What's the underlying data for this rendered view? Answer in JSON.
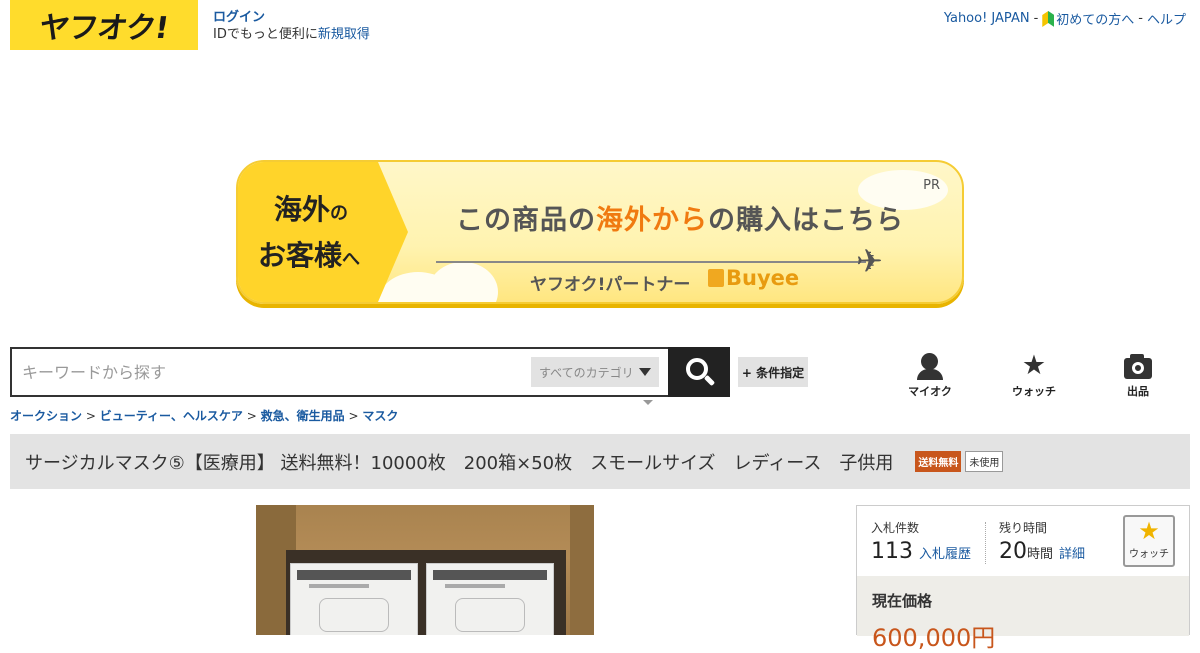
{
  "header": {
    "logo_text": "ヤフオク!",
    "login_label": "ログイン",
    "id_text": "IDでもっと便利に",
    "signup_link": "新規取得",
    "links": [
      "Yahoo! JAPAN",
      "初めての方へ",
      "ヘルプ"
    ],
    "separator": "-"
  },
  "banner": {
    "left_line1": "海外",
    "left_line1_suffix": "の",
    "left_line2": "お客様",
    "left_line2_suffix": "へ",
    "main_pre": "この商品の",
    "main_highlight": "海外から",
    "main_post": "の購入はこちら",
    "sub": "ヤフオク!パートナー",
    "brand": "Buyee",
    "pr": "PR"
  },
  "search": {
    "placeholder": "キーワードから探す",
    "category": "すべてのカテゴリ",
    "condition_label": "+ 条件指定"
  },
  "nav_icons": [
    {
      "label": "マイオク",
      "icon": "person-icon"
    },
    {
      "label": "ウォッチ",
      "icon": "star-icon"
    },
    {
      "label": "出品",
      "icon": "camera-icon"
    }
  ],
  "breadcrumb": [
    "オークション",
    "ビューティー、ヘルスケア",
    "救急、衛生用品",
    "マスク"
  ],
  "breadcrumb_sep": ">",
  "item": {
    "title": "サージカルマスク⑤【医療用】 送料無料！10000枚　200箱×50枚　スモールサイズ　レディース　子供用",
    "tag_shipping": "送料無料",
    "tag_condition": "未使用"
  },
  "bid_panel": {
    "bids_label": "入札件数",
    "bids_value": "113",
    "bid_history_link": "入札履歴",
    "time_label": "残り時間",
    "time_value": "20",
    "time_unit": "時間",
    "detail_link": "詳細",
    "watch_label": "ウォッチ",
    "price_label": "現在価格",
    "price_value": "600,000円"
  },
  "colors": {
    "brand_yellow": "#ffdc2c",
    "link_blue": "#1a5aa0",
    "price_orange": "#c8561c",
    "banner_highlight": "#f07a10"
  }
}
